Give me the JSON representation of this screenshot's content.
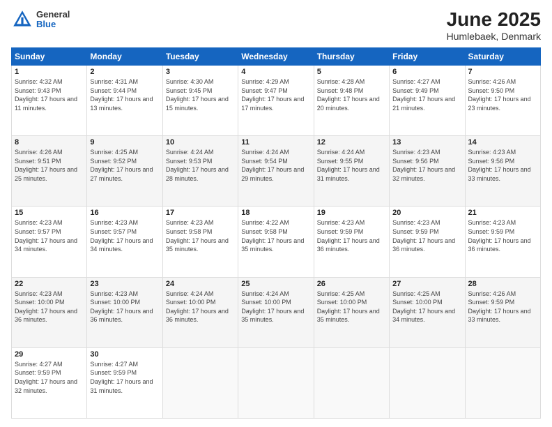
{
  "logo": {
    "general": "General",
    "blue": "Blue"
  },
  "title": "June 2025",
  "subtitle": "Humlebaek, Denmark",
  "days_header": [
    "Sunday",
    "Monday",
    "Tuesday",
    "Wednesday",
    "Thursday",
    "Friday",
    "Saturday"
  ],
  "weeks": [
    [
      {
        "num": "1",
        "sunrise": "4:32 AM",
        "sunset": "9:43 PM",
        "daylight": "17 hours and 11 minutes."
      },
      {
        "num": "2",
        "sunrise": "4:31 AM",
        "sunset": "9:44 PM",
        "daylight": "17 hours and 13 minutes."
      },
      {
        "num": "3",
        "sunrise": "4:30 AM",
        "sunset": "9:45 PM",
        "daylight": "17 hours and 15 minutes."
      },
      {
        "num": "4",
        "sunrise": "4:29 AM",
        "sunset": "9:47 PM",
        "daylight": "17 hours and 17 minutes."
      },
      {
        "num": "5",
        "sunrise": "4:28 AM",
        "sunset": "9:48 PM",
        "daylight": "17 hours and 20 minutes."
      },
      {
        "num": "6",
        "sunrise": "4:27 AM",
        "sunset": "9:49 PM",
        "daylight": "17 hours and 21 minutes."
      },
      {
        "num": "7",
        "sunrise": "4:26 AM",
        "sunset": "9:50 PM",
        "daylight": "17 hours and 23 minutes."
      }
    ],
    [
      {
        "num": "8",
        "sunrise": "4:26 AM",
        "sunset": "9:51 PM",
        "daylight": "17 hours and 25 minutes."
      },
      {
        "num": "9",
        "sunrise": "4:25 AM",
        "sunset": "9:52 PM",
        "daylight": "17 hours and 27 minutes."
      },
      {
        "num": "10",
        "sunrise": "4:24 AM",
        "sunset": "9:53 PM",
        "daylight": "17 hours and 28 minutes."
      },
      {
        "num": "11",
        "sunrise": "4:24 AM",
        "sunset": "9:54 PM",
        "daylight": "17 hours and 29 minutes."
      },
      {
        "num": "12",
        "sunrise": "4:24 AM",
        "sunset": "9:55 PM",
        "daylight": "17 hours and 31 minutes."
      },
      {
        "num": "13",
        "sunrise": "4:23 AM",
        "sunset": "9:56 PM",
        "daylight": "17 hours and 32 minutes."
      },
      {
        "num": "14",
        "sunrise": "4:23 AM",
        "sunset": "9:56 PM",
        "daylight": "17 hours and 33 minutes."
      }
    ],
    [
      {
        "num": "15",
        "sunrise": "4:23 AM",
        "sunset": "9:57 PM",
        "daylight": "17 hours and 34 minutes."
      },
      {
        "num": "16",
        "sunrise": "4:23 AM",
        "sunset": "9:57 PM",
        "daylight": "17 hours and 34 minutes."
      },
      {
        "num": "17",
        "sunrise": "4:23 AM",
        "sunset": "9:58 PM",
        "daylight": "17 hours and 35 minutes."
      },
      {
        "num": "18",
        "sunrise": "4:22 AM",
        "sunset": "9:58 PM",
        "daylight": "17 hours and 35 minutes."
      },
      {
        "num": "19",
        "sunrise": "4:23 AM",
        "sunset": "9:59 PM",
        "daylight": "17 hours and 36 minutes."
      },
      {
        "num": "20",
        "sunrise": "4:23 AM",
        "sunset": "9:59 PM",
        "daylight": "17 hours and 36 minutes."
      },
      {
        "num": "21",
        "sunrise": "4:23 AM",
        "sunset": "9:59 PM",
        "daylight": "17 hours and 36 minutes."
      }
    ],
    [
      {
        "num": "22",
        "sunrise": "4:23 AM",
        "sunset": "10:00 PM",
        "daylight": "17 hours and 36 minutes."
      },
      {
        "num": "23",
        "sunrise": "4:23 AM",
        "sunset": "10:00 PM",
        "daylight": "17 hours and 36 minutes."
      },
      {
        "num": "24",
        "sunrise": "4:24 AM",
        "sunset": "10:00 PM",
        "daylight": "17 hours and 36 minutes."
      },
      {
        "num": "25",
        "sunrise": "4:24 AM",
        "sunset": "10:00 PM",
        "daylight": "17 hours and 35 minutes."
      },
      {
        "num": "26",
        "sunrise": "4:25 AM",
        "sunset": "10:00 PM",
        "daylight": "17 hours and 35 minutes."
      },
      {
        "num": "27",
        "sunrise": "4:25 AM",
        "sunset": "10:00 PM",
        "daylight": "17 hours and 34 minutes."
      },
      {
        "num": "28",
        "sunrise": "4:26 AM",
        "sunset": "9:59 PM",
        "daylight": "17 hours and 33 minutes."
      }
    ],
    [
      {
        "num": "29",
        "sunrise": "4:27 AM",
        "sunset": "9:59 PM",
        "daylight": "17 hours and 32 minutes."
      },
      {
        "num": "30",
        "sunrise": "4:27 AM",
        "sunset": "9:59 PM",
        "daylight": "17 hours and 31 minutes."
      },
      null,
      null,
      null,
      null,
      null
    ]
  ]
}
